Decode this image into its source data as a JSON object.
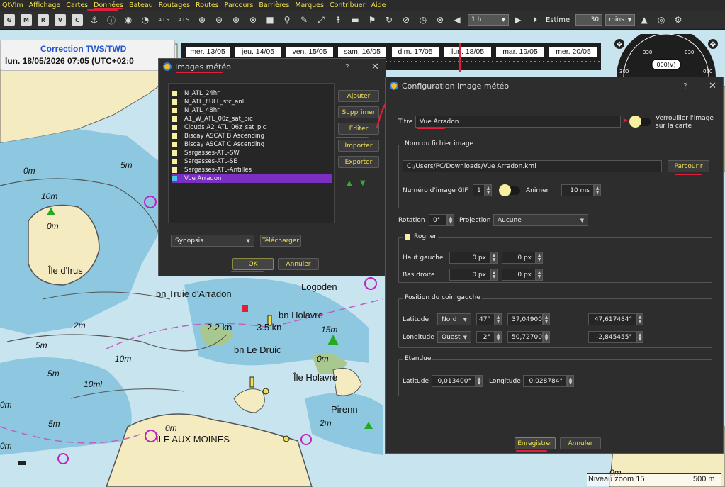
{
  "menu": [
    "QtVlm",
    "Affichage",
    "Cartes",
    "Données",
    "Bateau",
    "Routages",
    "Routes",
    "Parcours",
    "Barrières",
    "Marques",
    "Contribuer",
    "Aide"
  ],
  "toolbar": {
    "ais_label": "A.I.S",
    "step_combo": "1 h",
    "estime_label": "Estime",
    "estime_value": "30",
    "estime_unit": "mins"
  },
  "info": {
    "title": "Correction TWS/TWD",
    "datetime": "lun. 18/05/2026 07:05 (UTC+02:0"
  },
  "dates": [
    "mer. 13/05",
    "jeu. 14/05",
    "ven. 15/05",
    "sam. 16/05",
    "dim. 17/05",
    "lun. 18/05",
    "mar. 19/05",
    "mer. 20/05"
  ],
  "compass": {
    "label": "000(V)",
    "t330": "330",
    "t030": "030",
    "t300": "300",
    "t060": "060"
  },
  "images_dialog": {
    "title": "Images météo",
    "help": "?",
    "close": "✕",
    "items": [
      "N_ATL_24hr",
      "N_ATL_FULL_sfc_anl",
      "N_ATL_48hr",
      "A1_W_ATL_00z_sat_pic",
      "Clouds A2_ATL_06z_sat_pic",
      "Biscay ASCAT B Ascending",
      "Biscay ASCAT C Ascending",
      "Sargasses-ATL-SW",
      "Sargasses-ATL-SE",
      "Sargasses-ATL-Antilles",
      "Vue Arradon"
    ],
    "buttons": {
      "add": "Ajouter",
      "delete": "Supprimer",
      "edit": "Editer",
      "import": "Importer",
      "export": "Exporter"
    },
    "category": "Synopsis",
    "download": "Télécharger",
    "ok": "OK",
    "cancel": "Annuler"
  },
  "config_dialog": {
    "title": "Configuration image météo",
    "help": "?",
    "close": "✕",
    "titre_label": "Titre",
    "titre_value": "Vue Arradon",
    "lock_label_1": "Verrouiller l'image",
    "lock_label_2": "sur la carte",
    "file_group": "Nom du fichier image",
    "file_path": "C:/Users/PC/Downloads/Vue Arradon.kml",
    "browse": "Parcourir",
    "gif_label": "Numéro d'image GIF",
    "gif_value": "1",
    "animate_label": "Animer",
    "anim_value": "10 ms",
    "rotation_label": "Rotation",
    "rotation_value": "0°",
    "projection_label": "Projection",
    "projection_value": "Aucune",
    "crop_label": "Rogner",
    "top_left_label": "Haut gauche",
    "bottom_right_label": "Bas droite",
    "px_value": "0 px",
    "corner_group": "Position du coin gauche",
    "lat_label": "Latitude",
    "lat_hemi": "Nord",
    "lat_deg": "47°",
    "lat_min": "37,04900'",
    "lat_dec": "47,617484°",
    "lon_label": "Longitude",
    "lon_hemi": "Ouest",
    "lon_deg": "2°",
    "lon_min": "50,72700'",
    "lon_dec": "-2,845455°",
    "extent_group": "Etendue",
    "ext_lat_label": "Latitude",
    "ext_lat_value": "0,013400°",
    "ext_lon_label": "Longitude",
    "ext_lon_value": "0,028784°",
    "save": "Enregistrer",
    "cancel": "Annuler"
  },
  "map_labels": {
    "ile_irus": "Île d'Irus",
    "truie": "bn Truie d'Arradon",
    "logoden": "Logoden",
    "holavre": "bn Holavre",
    "druic": "bn Le Druic",
    "ile_holavre": "Île Holavre",
    "ile_moines": "ÎLE AUX MOINES",
    "pirenn": "Pirenn",
    "kn1": "2.2 kn",
    "kn2": "3.5 kn",
    "d_0m_a": "0m",
    "d_5m_a": "5m",
    "d_10m": "10m",
    "d_0m_b": "0m",
    "d_2m": "2m",
    "d_5m_b": "5m",
    "d_10m_b": "10m",
    "d_5m_c": "5m",
    "d_0m_c": "0m",
    "d_15m": "15m",
    "d_10ml": "10ml",
    "d_5m_d": "5m",
    "d_0m_d": "0m",
    "d_2m_b": "2m",
    "d_0m_e": "0m",
    "d_0m_f": "0m",
    "d_0m_g": "0m",
    "d_10m_c": "10m",
    "d_5m_e": "5m",
    "zoom": "Niveau zoom 15",
    "scale": "500 m"
  },
  "colors": {
    "land": "#f5ebc0",
    "deep": "#c8e4ee",
    "shallow": "#8ec8e0",
    "dry": "#a8c890",
    "accent": "#f0e050",
    "select": "#7a2ec2",
    "redmark": "#e0203a"
  }
}
